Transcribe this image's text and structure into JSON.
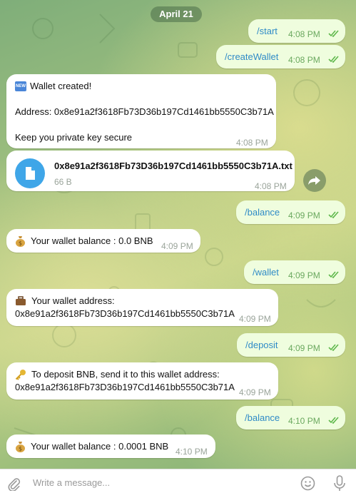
{
  "date_label": "April 21",
  "messages": [
    {
      "dir": "out",
      "text": "/start",
      "time": "4:08 PM"
    },
    {
      "dir": "out",
      "text": "/createWallet",
      "time": "4:08 PM"
    },
    {
      "dir": "in",
      "badge": "NEW",
      "line1": "Wallet created!",
      "line2": "Address: 0x8e91a2f3618Fb73D36b197Cd1461bb5550C3b71A",
      "line3": "Keep you private key secure",
      "time": "4:08 PM"
    },
    {
      "dir": "in",
      "type": "file",
      "file_name": "0x8e91a2f3618Fb73D36b197Cd1461bb5550C3b71A.txt",
      "file_size": "66 B",
      "time": "4:08 PM"
    },
    {
      "dir": "out",
      "text": "/balance",
      "time": "4:09 PM"
    },
    {
      "dir": "in",
      "icon": "money-bag-icon",
      "text": "Your wallet balance : 0.0 BNB",
      "time": "4:09 PM"
    },
    {
      "dir": "out",
      "text": "/wallet",
      "time": "4:09 PM"
    },
    {
      "dir": "in",
      "icon": "briefcase-icon",
      "line1": "Your wallet address:",
      "line2": "0x8e91a2f3618Fb73D36b197Cd1461bb5550C3b71A",
      "time": "4:09 PM"
    },
    {
      "dir": "out",
      "text": "/deposit",
      "time": "4:09 PM"
    },
    {
      "dir": "in",
      "icon": "key-icon",
      "line1": "To deposit BNB, send it to this wallet address:",
      "line2": "0x8e91a2f3618Fb73D36b197Cd1461bb5550C3b71A",
      "time": "4:09 PM"
    },
    {
      "dir": "out",
      "text": "/balance",
      "time": "4:10 PM"
    },
    {
      "dir": "in",
      "icon": "money-bag-icon",
      "text": "Your wallet balance : 0.0001 BNB",
      "time": "4:10 PM"
    }
  ],
  "composer": {
    "placeholder": "Write a message..."
  },
  "colors": {
    "outgoing_bubble": "#effdde",
    "link_text": "#2f8bc7",
    "file_icon": "#3fa6e8"
  }
}
